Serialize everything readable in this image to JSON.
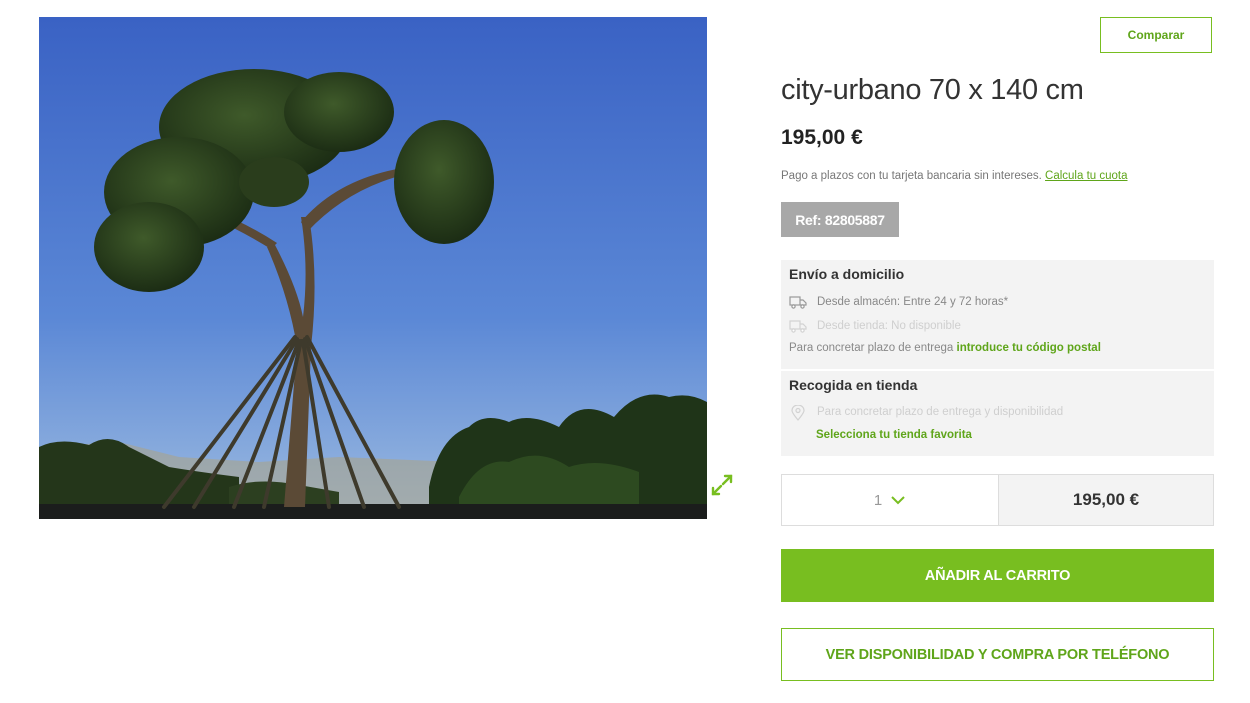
{
  "product": {
    "compare_label": "Comparar",
    "title": "city-urbano 70 x 140 cm",
    "price": "195,00 €",
    "installments_text": "Pago a plazos con tu tarjeta bancaria sin intereses.",
    "installments_link": "Calcula tu cuota",
    "reference": "Ref: 82805887",
    "image_icon": "tree-photo",
    "expand_icon": "expand-arrows-icon"
  },
  "delivery": {
    "title": "Envío a domicilio",
    "warehouse": "Desde almacén: Entre 24 y 72 horas*",
    "store": "Desde tienda: No disponible",
    "postal_prefix": "Para concretar plazo de entrega",
    "postal_link": "introduce tu código postal"
  },
  "pickup": {
    "title": "Recogida en tienda",
    "info": "Para concretar plazo de entrega y disponibilidad",
    "store_link": "Selecciona tu tienda favorita"
  },
  "cart": {
    "quantity": "1",
    "total": "195,00 €",
    "add_label": "AÑADIR AL CARRITO",
    "phone_label": "VER DISPONIBILIDAD Y COMPRA POR TELÉFONO"
  },
  "colors": {
    "accent": "#78be20",
    "accent_text": "#5fa51a",
    "ref_badge": "#a8a8a8",
    "panel_bg": "#f3f3f3"
  }
}
